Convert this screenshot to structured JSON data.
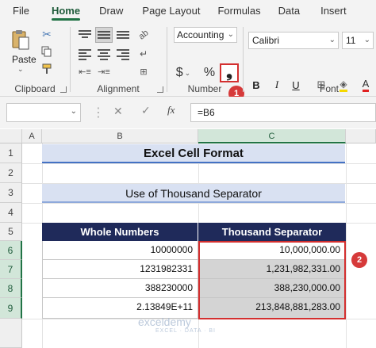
{
  "menu": {
    "tabs": [
      "File",
      "Home",
      "Draw",
      "Page Layout",
      "Formulas",
      "Data",
      "Insert"
    ],
    "active": "Home"
  },
  "ribbon": {
    "clipboard": {
      "label": "Clipboard",
      "paste_label": "Paste"
    },
    "alignment": {
      "label": "Alignment"
    },
    "number": {
      "label": "Number",
      "format_value": "Accounting",
      "currency_symbol": "$",
      "percent_symbol": "%",
      "comma_symbol": "❟"
    },
    "font": {
      "label": "Font",
      "font_name": "Calibri",
      "font_size": "11",
      "bold": "B",
      "italic": "I",
      "underline": "U"
    }
  },
  "callouts": {
    "one": "1",
    "two": "2"
  },
  "formula_bar": {
    "name_box": "",
    "fx_label": "fx",
    "formula": "=B6"
  },
  "grid": {
    "columns": [
      "A",
      "B",
      "C"
    ],
    "rows": [
      "1",
      "2",
      "3",
      "4",
      "5",
      "6",
      "7",
      "8",
      "9"
    ],
    "title": "Excel Cell Format",
    "subtitle": "Use of Thousand Separator",
    "headers": [
      "Whole Numbers",
      "Thousand Separator"
    ],
    "data": [
      [
        "10000000",
        "10,000,000.00"
      ],
      [
        "1231982331",
        "1,231,982,331.00"
      ],
      [
        "388230000",
        "388,230,000.00"
      ],
      [
        "2.13849E+11",
        "213,848,881,283.00"
      ]
    ]
  },
  "watermark": {
    "name": "exceldemy",
    "tagline": "EXCEL · DATA · BI"
  },
  "colors": {
    "excel_green": "#217346",
    "header_navy": "#1f2a5a",
    "title_fill": "#d9e1f2",
    "highlight_red": "#d32f2f"
  }
}
